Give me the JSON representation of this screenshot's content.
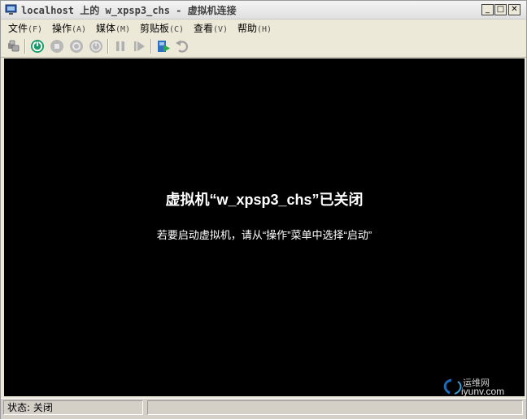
{
  "window": {
    "title": "localhost 上的 w_xpsp3_chs - 虚拟机连接",
    "minimize": "_",
    "maximize": "□",
    "close": "✕"
  },
  "menu": [
    {
      "label": "文件",
      "accel": "(F)"
    },
    {
      "label": "操作",
      "accel": "(A)"
    },
    {
      "label": "媒体",
      "accel": "(M)"
    },
    {
      "label": "剪贴板",
      "accel": "(C)"
    },
    {
      "label": "查看",
      "accel": "(V)"
    },
    {
      "label": "帮助",
      "accel": "(H)"
    }
  ],
  "toolbar": {
    "icons": [
      "ctrl-alt-del-icon",
      "start-icon",
      "turn-off-icon",
      "shut-down-icon",
      "save-icon",
      "pause-icon",
      "resume-icon",
      "snapshot-icon",
      "revert-icon"
    ]
  },
  "screen": {
    "title": "虚拟机“w_xpsp3_chs”已关闭",
    "subtitle": "若要启动虚拟机，请从“操作”菜单中选择“启动”"
  },
  "watermark": {
    "cn": "运维网",
    "en": "iyunv.com"
  },
  "status": {
    "text": "状态: 关闭"
  }
}
